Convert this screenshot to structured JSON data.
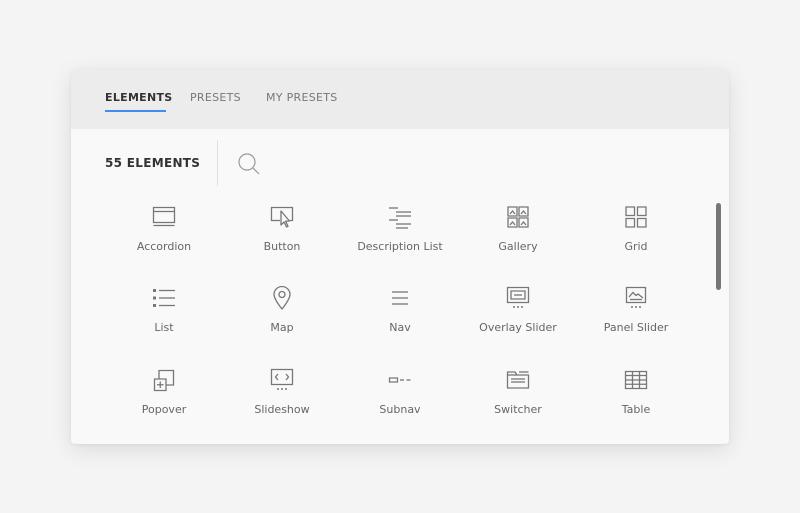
{
  "tabs": [
    {
      "label": "ELEMENTS",
      "active": true
    },
    {
      "label": "PRESETS",
      "active": false
    },
    {
      "label": "MY PRESETS",
      "active": false
    }
  ],
  "count_label": "55 ELEMENTS",
  "search": {
    "placeholder": "",
    "value": ""
  },
  "colors": {
    "accent": "#3d8ef0",
    "icon": "#777777",
    "panel": "#f9f9f9",
    "tabbar": "#ececec"
  },
  "elements": [
    {
      "label": "Accordion",
      "icon": "accordion-icon"
    },
    {
      "label": "Button",
      "icon": "button-icon"
    },
    {
      "label": "Description List",
      "icon": "description-list-icon"
    },
    {
      "label": "Gallery",
      "icon": "gallery-icon"
    },
    {
      "label": "Grid",
      "icon": "grid-icon"
    },
    {
      "label": "List",
      "icon": "list-icon"
    },
    {
      "label": "Map",
      "icon": "map-icon"
    },
    {
      "label": "Nav",
      "icon": "nav-icon"
    },
    {
      "label": "Overlay Slider",
      "icon": "overlay-slider-icon"
    },
    {
      "label": "Panel Slider",
      "icon": "panel-slider-icon"
    },
    {
      "label": "Popover",
      "icon": "popover-icon"
    },
    {
      "label": "Slideshow",
      "icon": "slideshow-icon"
    },
    {
      "label": "Subnav",
      "icon": "subnav-icon"
    },
    {
      "label": "Switcher",
      "icon": "switcher-icon"
    },
    {
      "label": "Table",
      "icon": "table-icon"
    }
  ]
}
